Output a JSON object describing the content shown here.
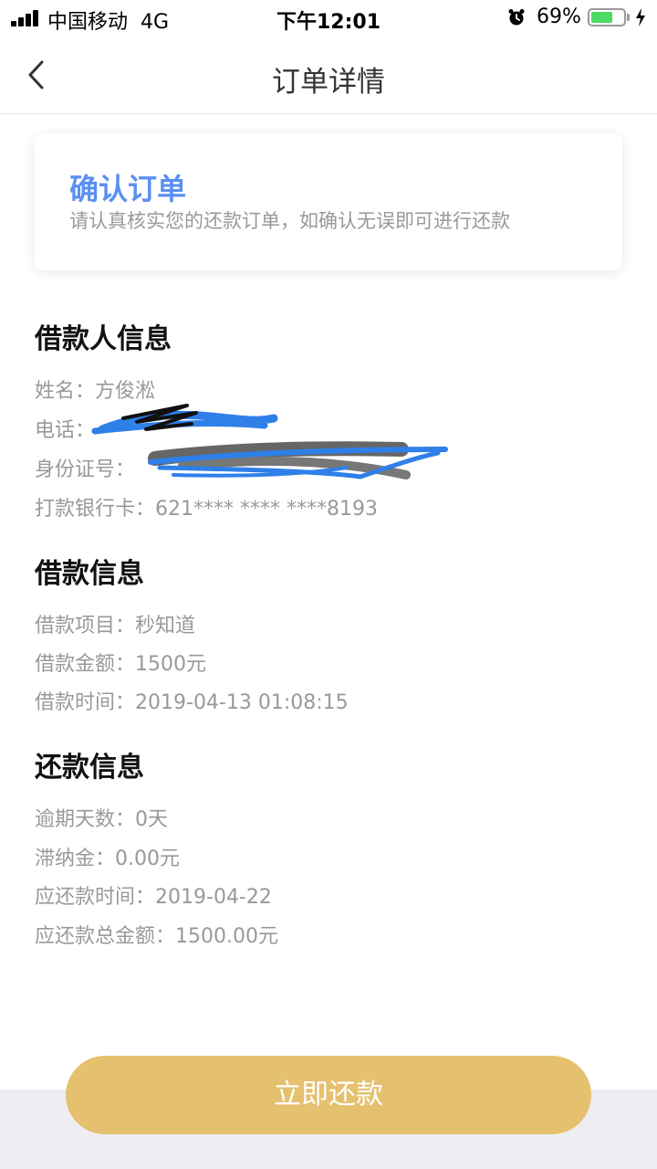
{
  "status_bar": {
    "carrier": "中国移动",
    "network": "4G",
    "time": "下午12:01",
    "battery_pct_label": "69%",
    "battery_level": 0.69,
    "icons": [
      "signal-icon",
      "alarm-icon",
      "battery-icon",
      "charging-bolt-icon"
    ]
  },
  "nav": {
    "title": "订单详情",
    "back_icon": "chevron-left-icon"
  },
  "confirm_card": {
    "title": "确认订单",
    "description": "请认真核实您的还款订单，如确认无误即可进行还款"
  },
  "borrower": {
    "title": "借款人信息",
    "name_label": "姓名：",
    "name_value": "方俊淞",
    "phone_label": "电话：",
    "id_label": "身份证号：",
    "bank_label": "打款银行卡：",
    "bank_value": "621**** **** ****8193"
  },
  "loan": {
    "title": "借款信息",
    "project_label": "借款项目：",
    "project_value": "秒知道",
    "amount_label": "借款金额：",
    "amount_value": "1500元",
    "time_label": "借款时间：",
    "time_value": "2019-04-13 01:08:15"
  },
  "repayment": {
    "title": "还款信息",
    "overdue_label": "逾期天数：",
    "overdue_value": "0天",
    "late_fee_label": "滞纳金：",
    "late_fee_value": "0.00元",
    "due_date_label": "应还款时间：",
    "due_date_value": "2019-04-22",
    "total_label": "应还款总金额：",
    "total_value": "1500.00元"
  },
  "actions": {
    "pay_now": "立即还款"
  },
  "colors": {
    "accent_blue": "#5b8ff2",
    "button_gold": "#e5c06e",
    "battery_green": "#4cd964",
    "redaction_blue": "#2f7fe8"
  }
}
